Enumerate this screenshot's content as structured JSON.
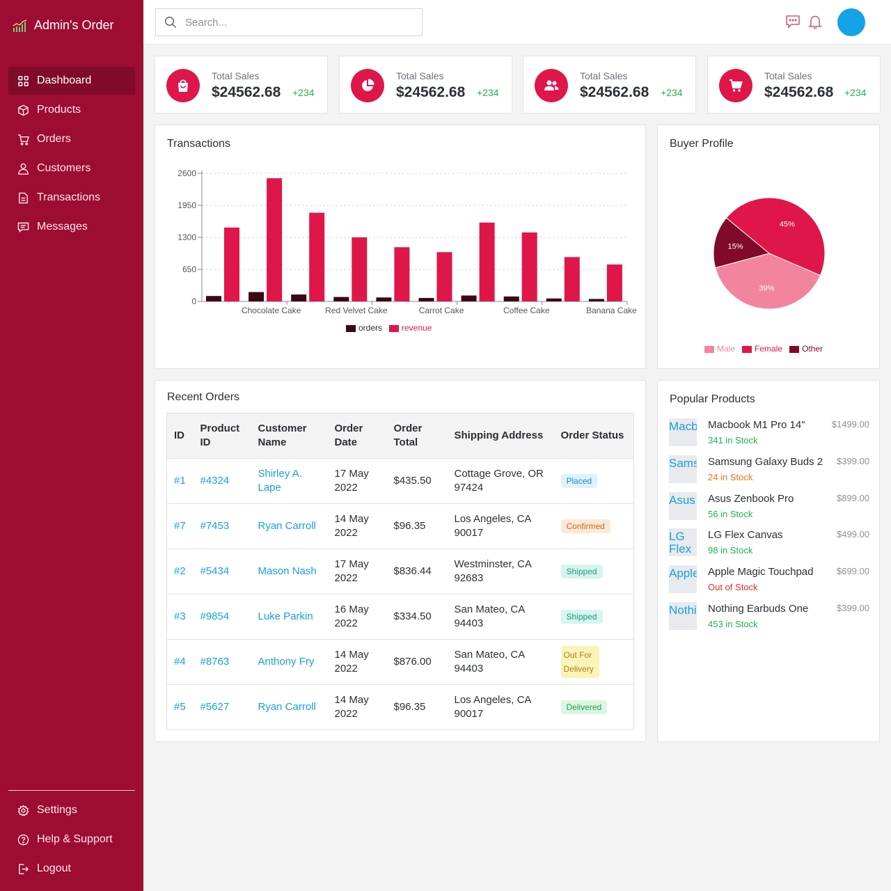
{
  "app": {
    "title": "Admin's Order"
  },
  "nav": {
    "items": [
      {
        "label": "Dashboard",
        "icon": "grid-icon",
        "active": true
      },
      {
        "label": "Products",
        "icon": "box-icon"
      },
      {
        "label": "Orders",
        "icon": "cart-icon"
      },
      {
        "label": "Customers",
        "icon": "users-icon"
      },
      {
        "label": "Transactions",
        "icon": "document-icon"
      },
      {
        "label": "Messages",
        "icon": "message-icon"
      }
    ],
    "bottom": [
      {
        "label": "Settings",
        "icon": "gear-icon"
      },
      {
        "label": "Help & Support",
        "icon": "help-icon"
      },
      {
        "label": "Logout",
        "icon": "logout-icon"
      }
    ]
  },
  "search": {
    "placeholder": "Search..."
  },
  "colors": {
    "sidebar": "#9c0c33",
    "accent": "#df1649",
    "avatar": "#13a3e6",
    "positive": "#22b04e"
  },
  "stats": [
    {
      "label": "Total Sales",
      "value": "$24562.68",
      "change": "+234",
      "icon": "shopping-bag-icon"
    },
    {
      "label": "Total Sales",
      "value": "$24562.68",
      "change": "+234",
      "icon": "pie-chart-icon"
    },
    {
      "label": "Total Sales",
      "value": "$24562.68",
      "change": "+234",
      "icon": "users-icon"
    },
    {
      "label": "Total Sales",
      "value": "$24562.68",
      "change": "+234",
      "icon": "shopping-cart-icon"
    }
  ],
  "transactions": {
    "title": "Transactions"
  },
  "buyer_profile": {
    "title": "Buyer Profile"
  },
  "chart_data": [
    {
      "type": "bar",
      "title": "Transactions",
      "categories": [
        "",
        "Chocolate Cake",
        "",
        "Red Velvet Cake",
        "",
        "Carrot Cake",
        "",
        "Coffee Cake",
        "",
        "Banana Cake"
      ],
      "series": [
        {
          "name": "orders",
          "color": "#3a0812",
          "values": [
            110,
            190,
            140,
            90,
            80,
            70,
            120,
            100,
            60,
            50
          ]
        },
        {
          "name": "revenue",
          "color": "#df1649",
          "values": [
            1500,
            2500,
            1800,
            1300,
            1100,
            1000,
            1600,
            1400,
            900,
            750
          ]
        }
      ],
      "yticks": [
        "0",
        "650",
        "1300",
        "1950",
        "2600"
      ],
      "ylim": [
        0,
        2600
      ],
      "grid": true,
      "legend": "bottom"
    },
    {
      "type": "pie",
      "title": "Buyer Profile",
      "slices": [
        {
          "name": "Male",
          "value": 39,
          "label": "39%",
          "color": "#f2849f"
        },
        {
          "name": "Female",
          "value": 45,
          "label": "45%",
          "color": "#df1649"
        },
        {
          "name": "Other",
          "value": 15,
          "label": "15%",
          "color": "#7f0a29"
        }
      ],
      "legend": "bottom"
    }
  ],
  "recent_orders": {
    "title": "Recent Orders",
    "columns": [
      "ID",
      "Product ID",
      "Customer Name",
      "Order Date",
      "Order Total",
      "Shipping Address",
      "Order Status"
    ],
    "rows": [
      {
        "id": "#1",
        "product_id": "#4324",
        "customer": "Shirley A. Lape",
        "date": "17 May 2022",
        "total": "$435.50",
        "address": "Cottage Grove, OR 97424",
        "status": "Placed",
        "status_class": "b-placed"
      },
      {
        "id": "#7",
        "product_id": "#7453",
        "customer": "Ryan Carroll",
        "date": "14 May 2022",
        "total": "$96.35",
        "address": "Los Angeles, CA 90017",
        "status": "Confirmed",
        "status_class": "b-confirmed"
      },
      {
        "id": "#2",
        "product_id": "#5434",
        "customer": "Mason Nash",
        "date": "17 May 2022",
        "total": "$836.44",
        "address": "Westminster, CA 92683",
        "status": "Shipped",
        "status_class": "b-shipped"
      },
      {
        "id": "#3",
        "product_id": "#9854",
        "customer": "Luke Parkin",
        "date": "16 May 2022",
        "total": "$334.50",
        "address": "San Mateo, CA 94403",
        "status": "Shipped",
        "status_class": "b-shipped"
      },
      {
        "id": "#4",
        "product_id": "#8763",
        "customer": "Anthony Fry",
        "date": "14 May 2022",
        "total": "$876.00",
        "address": "San Mateo, CA 94403",
        "status": "Out For Delivery",
        "status_class": "b-out"
      },
      {
        "id": "#5",
        "product_id": "#5627",
        "customer": "Ryan Carroll",
        "date": "14 May 2022",
        "total": "$96.35",
        "address": "Los Angeles, CA 90017",
        "status": "Delivered",
        "status_class": "b-delivered"
      }
    ]
  },
  "popular_products": {
    "title": "Popular Products",
    "items": [
      {
        "thumb": "Macb",
        "name": "Macbook M1 Pro 14\"",
        "stock": "341 in Stock",
        "stock_class": "in",
        "price": "$1499.00"
      },
      {
        "thumb": "Sams",
        "name": "Samsung Galaxy Buds 2",
        "stock": "24 in Stock",
        "stock_class": "low",
        "price": "$399.00"
      },
      {
        "thumb": "Asus",
        "name": "Asus Zenbook Pro",
        "stock": "56 in Stock",
        "stock_class": "in",
        "price": "$899.00"
      },
      {
        "thumb": "LG Flex",
        "name": "LG Flex Canvas",
        "stock": "98 in Stock",
        "stock_class": "in",
        "price": "$499.00"
      },
      {
        "thumb": "Apple",
        "name": "Apple Magic Touchpad",
        "stock": "Out of Stock",
        "stock_class": "out",
        "price": "$699.00"
      },
      {
        "thumb": "Nothi",
        "name": "Nothing Earbuds One",
        "stock": "453 in Stock",
        "stock_class": "in",
        "price": "$399.00"
      }
    ]
  }
}
